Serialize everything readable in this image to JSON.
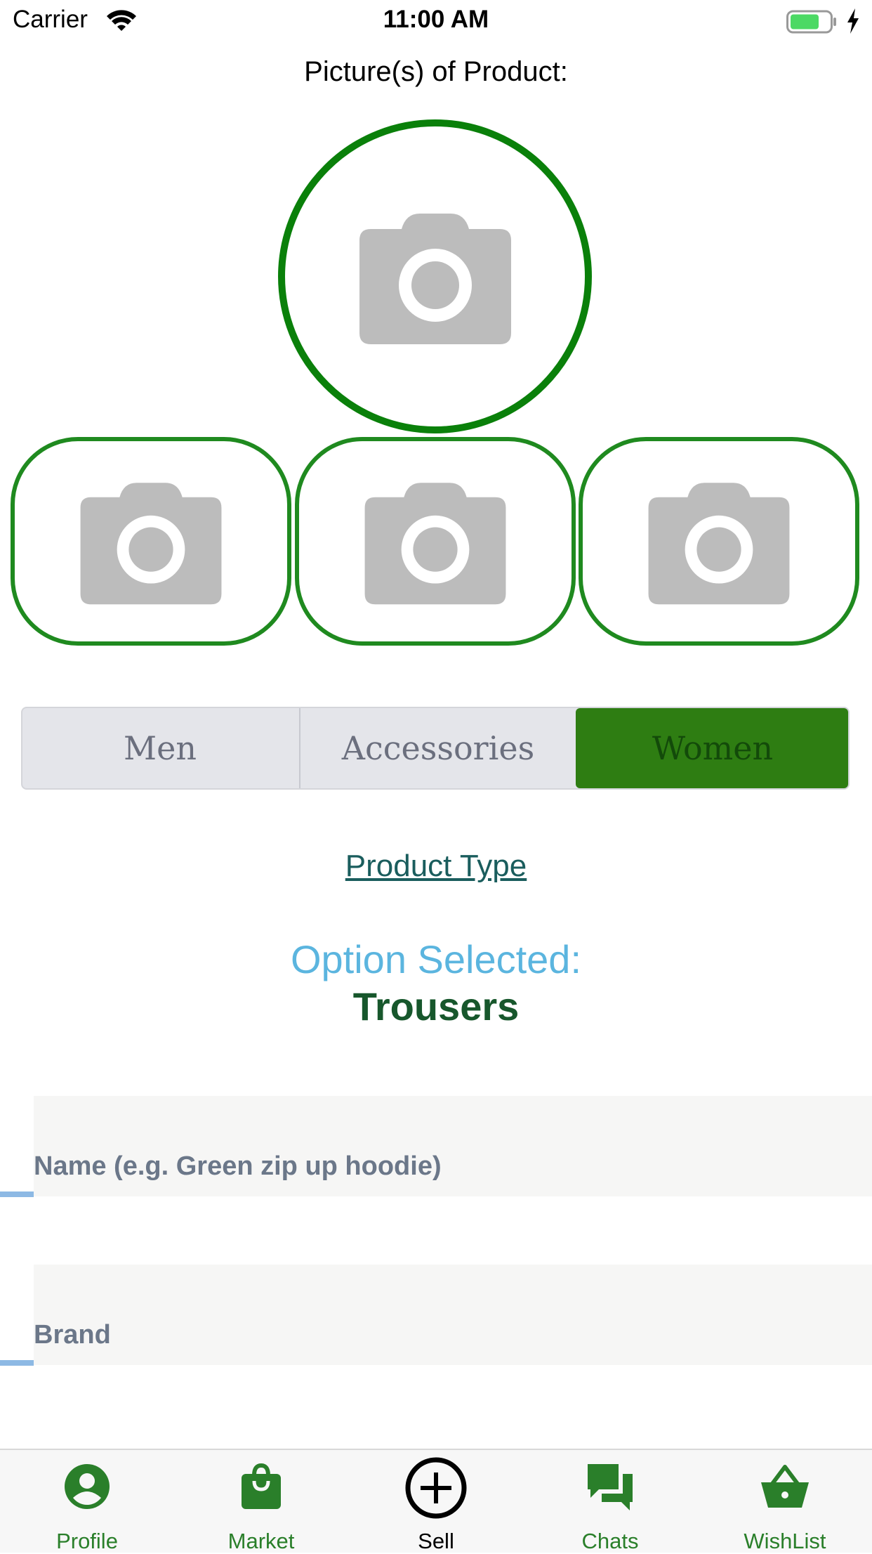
{
  "status_bar": {
    "carrier": "Carrier",
    "time": "11:00 AM"
  },
  "page": {
    "title": "Picture(s) of Product:"
  },
  "photos": {
    "main_icon": "camera-icon",
    "thumb_icon": "camera-icon",
    "thumb_count": 3
  },
  "category": {
    "options": [
      "Men",
      "Accessories",
      "Women"
    ],
    "selected": "Women",
    "accent_color": "#2e7d12"
  },
  "product_type": {
    "link_label": "Product Type",
    "option_label": "Option Selected:",
    "option_value": "Trousers"
  },
  "form": {
    "name_placeholder": "Name (e.g. Green zip up hoodie)",
    "brand_placeholder": "Brand"
  },
  "tab_bar": {
    "items": [
      {
        "label": "Profile",
        "icon": "person-circle-icon"
      },
      {
        "label": "Market",
        "icon": "shopping-bag-icon"
      },
      {
        "label": "Sell",
        "icon": "plus-circle-icon"
      },
      {
        "label": "Chats",
        "icon": "chat-bubbles-icon"
      },
      {
        "label": "WishList",
        "icon": "basket-icon"
      }
    ],
    "active": "Sell",
    "accent_color": "#2a7f2a"
  }
}
